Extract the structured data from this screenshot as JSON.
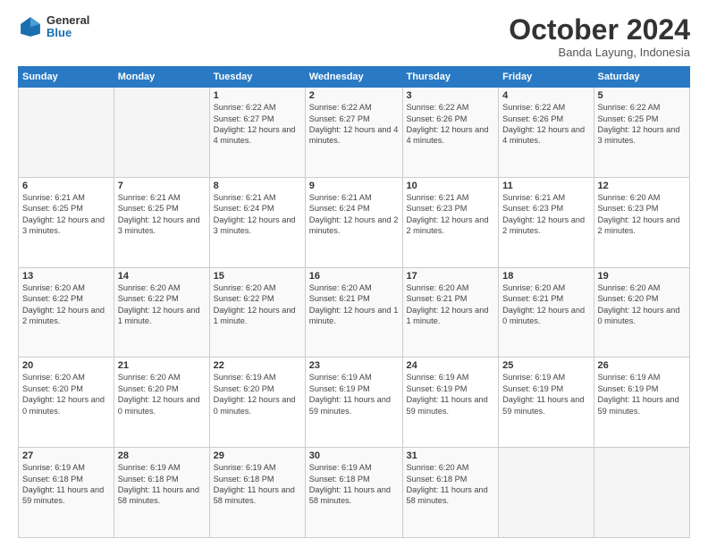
{
  "logo": {
    "text1": "General",
    "text2": "Blue"
  },
  "header": {
    "month": "October 2024",
    "location": "Banda Layung, Indonesia"
  },
  "weekdays": [
    "Sunday",
    "Monday",
    "Tuesday",
    "Wednesday",
    "Thursday",
    "Friday",
    "Saturday"
  ],
  "weeks": [
    [
      {
        "day": "",
        "info": ""
      },
      {
        "day": "",
        "info": ""
      },
      {
        "day": "1",
        "info": "Sunrise: 6:22 AM\nSunset: 6:27 PM\nDaylight: 12 hours\nand 4 minutes."
      },
      {
        "day": "2",
        "info": "Sunrise: 6:22 AM\nSunset: 6:27 PM\nDaylight: 12 hours\nand 4 minutes."
      },
      {
        "day": "3",
        "info": "Sunrise: 6:22 AM\nSunset: 6:26 PM\nDaylight: 12 hours\nand 4 minutes."
      },
      {
        "day": "4",
        "info": "Sunrise: 6:22 AM\nSunset: 6:26 PM\nDaylight: 12 hours\nand 4 minutes."
      },
      {
        "day": "5",
        "info": "Sunrise: 6:22 AM\nSunset: 6:25 PM\nDaylight: 12 hours\nand 3 minutes."
      }
    ],
    [
      {
        "day": "6",
        "info": "Sunrise: 6:21 AM\nSunset: 6:25 PM\nDaylight: 12 hours\nand 3 minutes."
      },
      {
        "day": "7",
        "info": "Sunrise: 6:21 AM\nSunset: 6:25 PM\nDaylight: 12 hours\nand 3 minutes."
      },
      {
        "day": "8",
        "info": "Sunrise: 6:21 AM\nSunset: 6:24 PM\nDaylight: 12 hours\nand 3 minutes."
      },
      {
        "day": "9",
        "info": "Sunrise: 6:21 AM\nSunset: 6:24 PM\nDaylight: 12 hours\nand 2 minutes."
      },
      {
        "day": "10",
        "info": "Sunrise: 6:21 AM\nSunset: 6:23 PM\nDaylight: 12 hours\nand 2 minutes."
      },
      {
        "day": "11",
        "info": "Sunrise: 6:21 AM\nSunset: 6:23 PM\nDaylight: 12 hours\nand 2 minutes."
      },
      {
        "day": "12",
        "info": "Sunrise: 6:20 AM\nSunset: 6:23 PM\nDaylight: 12 hours\nand 2 minutes."
      }
    ],
    [
      {
        "day": "13",
        "info": "Sunrise: 6:20 AM\nSunset: 6:22 PM\nDaylight: 12 hours\nand 2 minutes."
      },
      {
        "day": "14",
        "info": "Sunrise: 6:20 AM\nSunset: 6:22 PM\nDaylight: 12 hours\nand 1 minute."
      },
      {
        "day": "15",
        "info": "Sunrise: 6:20 AM\nSunset: 6:22 PM\nDaylight: 12 hours\nand 1 minute."
      },
      {
        "day": "16",
        "info": "Sunrise: 6:20 AM\nSunset: 6:21 PM\nDaylight: 12 hours\nand 1 minute."
      },
      {
        "day": "17",
        "info": "Sunrise: 6:20 AM\nSunset: 6:21 PM\nDaylight: 12 hours\nand 1 minute."
      },
      {
        "day": "18",
        "info": "Sunrise: 6:20 AM\nSunset: 6:21 PM\nDaylight: 12 hours\nand 0 minutes."
      },
      {
        "day": "19",
        "info": "Sunrise: 6:20 AM\nSunset: 6:20 PM\nDaylight: 12 hours\nand 0 minutes."
      }
    ],
    [
      {
        "day": "20",
        "info": "Sunrise: 6:20 AM\nSunset: 6:20 PM\nDaylight: 12 hours\nand 0 minutes."
      },
      {
        "day": "21",
        "info": "Sunrise: 6:20 AM\nSunset: 6:20 PM\nDaylight: 12 hours\nand 0 minutes."
      },
      {
        "day": "22",
        "info": "Sunrise: 6:19 AM\nSunset: 6:20 PM\nDaylight: 12 hours\nand 0 minutes."
      },
      {
        "day": "23",
        "info": "Sunrise: 6:19 AM\nSunset: 6:19 PM\nDaylight: 11 hours\nand 59 minutes."
      },
      {
        "day": "24",
        "info": "Sunrise: 6:19 AM\nSunset: 6:19 PM\nDaylight: 11 hours\nand 59 minutes."
      },
      {
        "day": "25",
        "info": "Sunrise: 6:19 AM\nSunset: 6:19 PM\nDaylight: 11 hours\nand 59 minutes."
      },
      {
        "day": "26",
        "info": "Sunrise: 6:19 AM\nSunset: 6:19 PM\nDaylight: 11 hours\nand 59 minutes."
      }
    ],
    [
      {
        "day": "27",
        "info": "Sunrise: 6:19 AM\nSunset: 6:18 PM\nDaylight: 11 hours\nand 59 minutes."
      },
      {
        "day": "28",
        "info": "Sunrise: 6:19 AM\nSunset: 6:18 PM\nDaylight: 11 hours\nand 58 minutes."
      },
      {
        "day": "29",
        "info": "Sunrise: 6:19 AM\nSunset: 6:18 PM\nDaylight: 11 hours\nand 58 minutes."
      },
      {
        "day": "30",
        "info": "Sunrise: 6:19 AM\nSunset: 6:18 PM\nDaylight: 11 hours\nand 58 minutes."
      },
      {
        "day": "31",
        "info": "Sunrise: 6:20 AM\nSunset: 6:18 PM\nDaylight: 11 hours\nand 58 minutes."
      },
      {
        "day": "",
        "info": ""
      },
      {
        "day": "",
        "info": ""
      }
    ]
  ]
}
